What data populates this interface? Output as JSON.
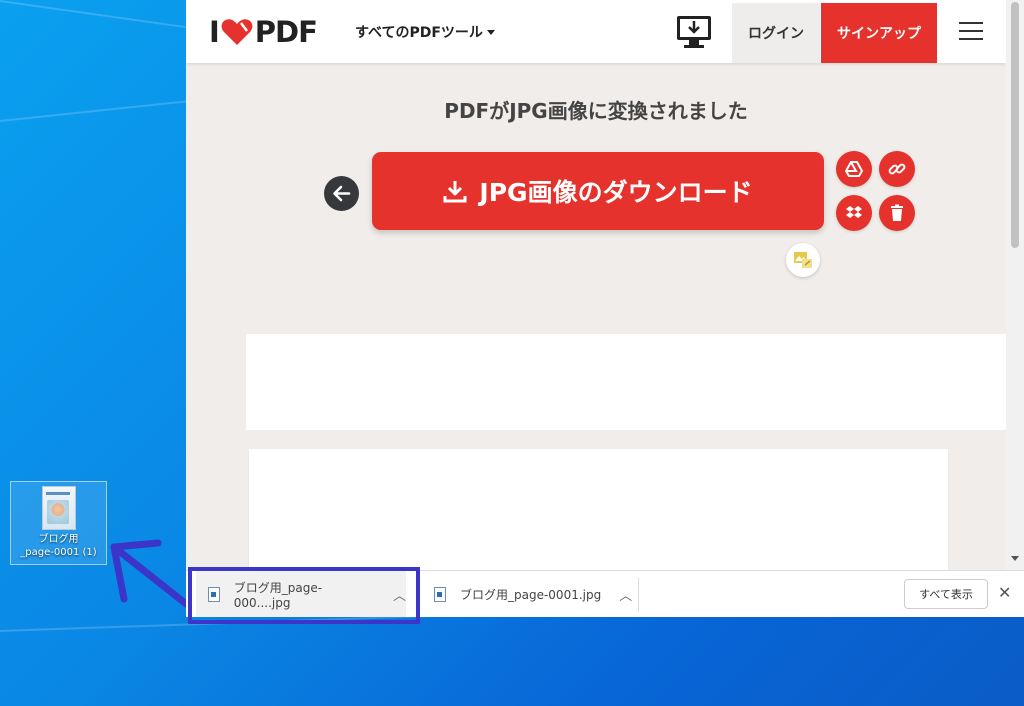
{
  "desktop": {
    "file_icon_label_line1": "ブログ用",
    "file_icon_label_line2": "_page-0001 (1)"
  },
  "header": {
    "logo_left": "I",
    "logo_right": "PDF",
    "tools_menu_label": "すべてのPDFツール",
    "login_label": "ログイン",
    "signup_label": "サインアップ"
  },
  "main": {
    "heading": "PDFがJPG画像に変換されました",
    "download_button_label": "JPG画像のダウンロード"
  },
  "download_shelf": {
    "items": [
      {
        "filename": "ブログ用_page-000....jpg"
      },
      {
        "filename": "ブログ用_page-0001.jpg"
      }
    ],
    "show_all_label": "すべて表示"
  },
  "colors": {
    "brand_red": "#e5322d",
    "annotation_blue": "#3b35c9"
  },
  "icons": [
    "download-icon",
    "back-arrow-icon",
    "google-drive-icon",
    "link-icon",
    "dropbox-icon",
    "trash-icon",
    "image-preview-icon",
    "desktop-download-icon",
    "hamburger-icon",
    "chevron-up-icon",
    "close-icon",
    "file-icon"
  ]
}
